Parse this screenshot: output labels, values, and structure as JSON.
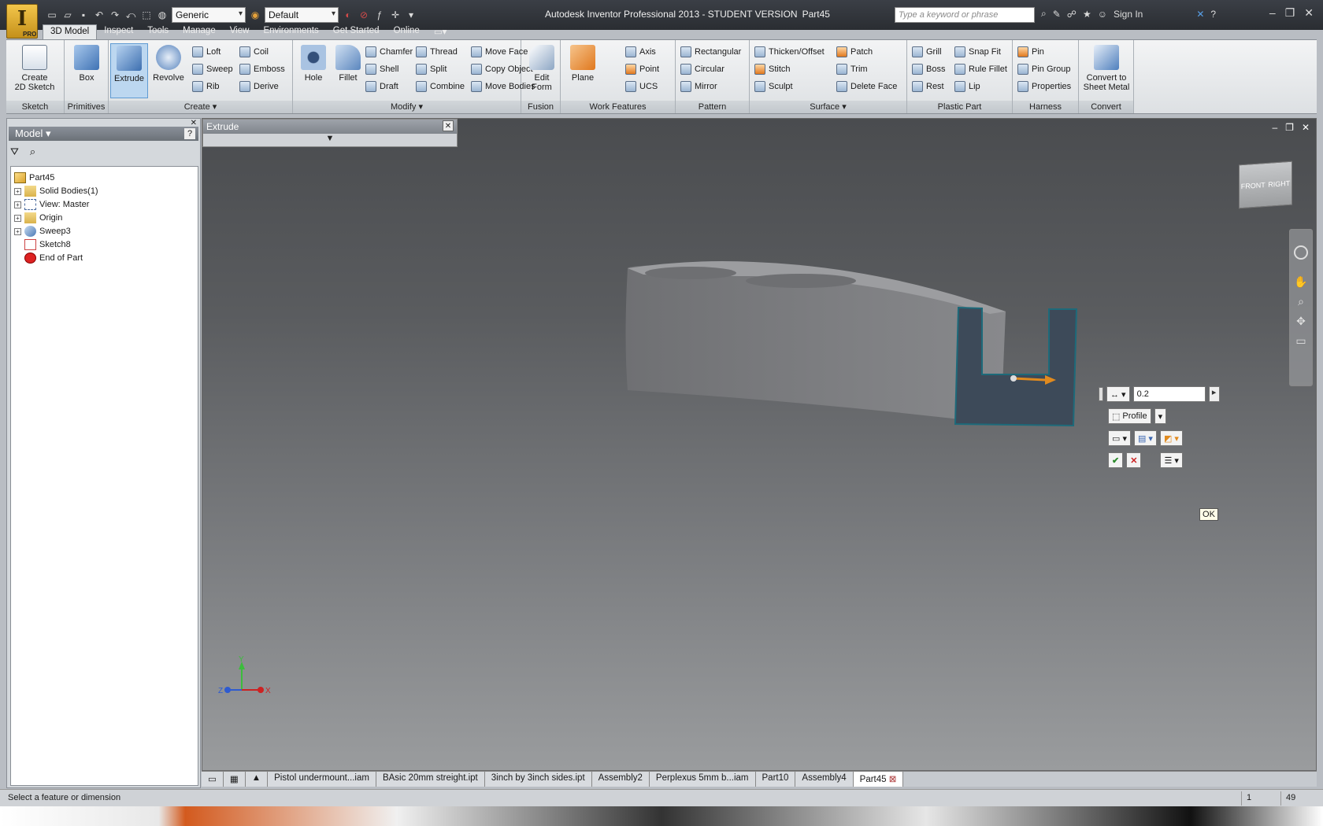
{
  "window": {
    "title": "Autodesk Inventor Professional 2013 - STUDENT VERSION",
    "document": "Part45",
    "app_button": "I",
    "app_badge": "PRO",
    "style_combo": "Generic",
    "appearance_combo": "Default",
    "search_placeholder": "Type a keyword or phrase",
    "sign_in": "Sign In"
  },
  "menu_tabs": [
    "3D Model",
    "Inspect",
    "Tools",
    "Manage",
    "View",
    "Environments",
    "Get Started",
    "Online"
  ],
  "ribbon": {
    "sketch": {
      "label": "Sketch",
      "create_2d_sketch": "Create\n2D Sketch"
    },
    "primitives": {
      "label": "Primitives",
      "box": "Box"
    },
    "create": {
      "label": "Create",
      "extrude": "Extrude",
      "revolve": "Revolve",
      "loft": "Loft",
      "sweep": "Sweep",
      "rib": "Rib",
      "coil": "Coil",
      "emboss": "Emboss",
      "derive": "Derive"
    },
    "modify": {
      "label": "Modify",
      "hole": "Hole",
      "fillet": "Fillet",
      "chamfer": "Chamfer",
      "shell": "Shell",
      "draft": "Draft",
      "thread": "Thread",
      "split": "Split",
      "combine": "Combine",
      "move_face": "Move Face",
      "copy_object": "Copy Object",
      "move_bodies": "Move Bodies"
    },
    "fusion": {
      "label": "Fusion",
      "edit_form": "Edit\nForm"
    },
    "work_features": {
      "label": "Work Features",
      "plane": "Plane",
      "axis": "Axis",
      "point": "Point",
      "ucs": "UCS"
    },
    "pattern": {
      "label": "Pattern",
      "rectangular": "Rectangular",
      "circular": "Circular",
      "mirror": "Mirror"
    },
    "surface": {
      "label": "Surface",
      "thicken": "Thicken/Offset",
      "stitch": "Stitch",
      "sculpt": "Sculpt",
      "patch": "Patch",
      "trim": "Trim",
      "delete_face": "Delete Face"
    },
    "plastic_part": {
      "label": "Plastic Part",
      "grill": "Grill",
      "boss": "Boss",
      "rest": "Rest",
      "snap_fit": "Snap Fit",
      "rule_fillet": "Rule Fillet",
      "lip": "Lip"
    },
    "harness": {
      "label": "Harness",
      "pin": "Pin",
      "pin_group": "Pin Group",
      "properties": "Properties"
    },
    "convert": {
      "label": "Convert",
      "convert_sheet_metal": "Convert to\nSheet Metal"
    }
  },
  "browser": {
    "title": "Model",
    "tree": [
      {
        "label": "Part45",
        "expandable": false
      },
      {
        "label": "Solid Bodies(1)",
        "expandable": true
      },
      {
        "label": "View: Master",
        "expandable": true
      },
      {
        "label": "Origin",
        "expandable": true
      },
      {
        "label": "Sweep3",
        "expandable": true
      },
      {
        "label": "Sketch8",
        "expandable": false
      },
      {
        "label": "End of Part",
        "expandable": false
      }
    ]
  },
  "extrude_dialog": {
    "title": "Extrude"
  },
  "viewcube": {
    "front": "FRONT",
    "right": "RIGHT"
  },
  "mini_toolbar": {
    "distance": "0.2",
    "profile": "Profile",
    "ok_tooltip": "OK"
  },
  "axes": {
    "x": "X",
    "y": "Y",
    "z": "Z"
  },
  "document_tabs": [
    "Pistol undermount...iam",
    "BAsic 20mm streight.ipt",
    "3inch by 3inch sides.ipt",
    "Assembly2",
    "Perplexus 5mm b...iam",
    "Part10",
    "Assembly4",
    "Part45"
  ],
  "active_document_tab": "Part45",
  "status": {
    "message": "Select a feature or dimension",
    "count1": "1",
    "count2": "49"
  },
  "colors": {
    "accent": "#5f9bd3",
    "profile_fill": "#3d4a59",
    "arrow": "#e08a1e"
  }
}
